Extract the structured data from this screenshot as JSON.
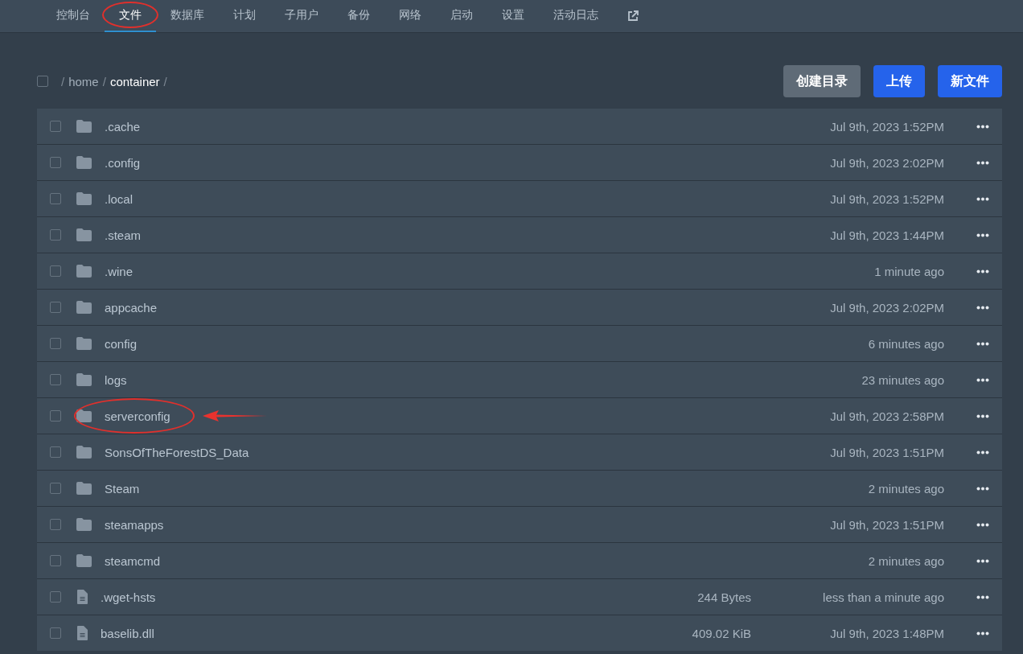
{
  "nav": {
    "tabs": [
      {
        "label": "控制台",
        "selected": false,
        "annotated": false
      },
      {
        "label": "文件",
        "selected": true,
        "annotated": true
      },
      {
        "label": "数据库",
        "selected": false,
        "annotated": false
      },
      {
        "label": "计划",
        "selected": false,
        "annotated": false
      },
      {
        "label": "子用户",
        "selected": false,
        "annotated": false
      },
      {
        "label": "备份",
        "selected": false,
        "annotated": false
      },
      {
        "label": "网络",
        "selected": false,
        "annotated": false
      },
      {
        "label": "启动",
        "selected": false,
        "annotated": false
      },
      {
        "label": "设置",
        "selected": false,
        "annotated": false
      },
      {
        "label": "活动日志",
        "selected": false,
        "annotated": false
      }
    ]
  },
  "toolbar": {
    "select_all_checked": false,
    "breadcrumb": [
      {
        "sep": "/",
        "label": "home",
        "current": false
      },
      {
        "sep": "/",
        "label": "container",
        "current": true
      }
    ],
    "breadcrumb_end": "/",
    "buttons": [
      {
        "label": "创建目录",
        "kind": "secondary"
      },
      {
        "label": "上传",
        "kind": "primary"
      },
      {
        "label": "新文件",
        "kind": "primary"
      }
    ]
  },
  "files": [
    {
      "kind": "folder",
      "name": ".cache",
      "modified": "Jul 9th, 2023 1:52PM",
      "checked": false,
      "annotated": false
    },
    {
      "kind": "folder",
      "name": ".config",
      "modified": "Jul 9th, 2023 2:02PM",
      "checked": false,
      "annotated": false
    },
    {
      "kind": "folder",
      "name": ".local",
      "modified": "Jul 9th, 2023 1:52PM",
      "checked": false,
      "annotated": false
    },
    {
      "kind": "folder",
      "name": ".steam",
      "modified": "Jul 9th, 2023 1:44PM",
      "checked": false,
      "annotated": false
    },
    {
      "kind": "folder",
      "name": ".wine",
      "modified": "1 minute ago",
      "checked": false,
      "annotated": false
    },
    {
      "kind": "folder",
      "name": "appcache",
      "modified": "Jul 9th, 2023 2:02PM",
      "checked": false,
      "annotated": false
    },
    {
      "kind": "folder",
      "name": "config",
      "modified": "6 minutes ago",
      "checked": false,
      "annotated": false
    },
    {
      "kind": "folder",
      "name": "logs",
      "modified": "23 minutes ago",
      "checked": false,
      "annotated": false
    },
    {
      "kind": "folder",
      "name": "serverconfig",
      "modified": "Jul 9th, 2023 2:58PM",
      "checked": false,
      "annotated": true
    },
    {
      "kind": "folder",
      "name": "SonsOfTheForestDS_Data",
      "modified": "Jul 9th, 2023 1:51PM",
      "checked": false,
      "annotated": false
    },
    {
      "kind": "folder",
      "name": "Steam",
      "modified": "2 minutes ago",
      "checked": false,
      "annotated": false
    },
    {
      "kind": "folder",
      "name": "steamapps",
      "modified": "Jul 9th, 2023 1:51PM",
      "checked": false,
      "annotated": false
    },
    {
      "kind": "folder",
      "name": "steamcmd",
      "modified": "2 minutes ago",
      "checked": false,
      "annotated": false
    },
    {
      "kind": "file",
      "name": ".wget-hsts",
      "size": "244 Bytes",
      "modified": "less than a minute ago",
      "checked": false,
      "annotated": false
    },
    {
      "kind": "file",
      "name": "baselib.dll",
      "size": "409.02 KiB",
      "modified": "Jul 9th, 2023 1:48PM",
      "checked": false,
      "annotated": false
    }
  ]
}
